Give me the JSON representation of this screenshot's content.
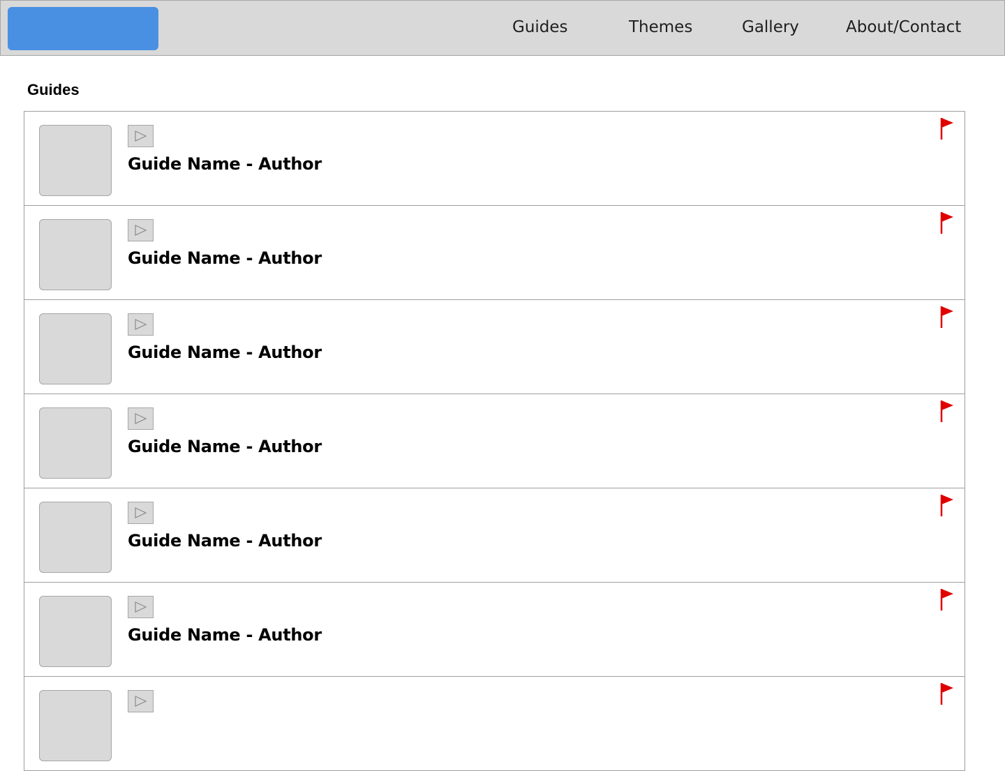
{
  "nav": {
    "links": [
      "Guides",
      "Themes",
      "Gallery",
      "About/Contact"
    ]
  },
  "page": {
    "section_title": "Guides"
  },
  "guides": [
    {
      "title": "Guide Name - Author"
    },
    {
      "title": "Guide Name - Author"
    },
    {
      "title": "Guide Name - Author"
    },
    {
      "title": "Guide Name - Author"
    },
    {
      "title": "Guide Name - Author"
    },
    {
      "title": "Guide Name - Author"
    },
    {
      "title": ""
    }
  ],
  "icons": {
    "play": "play-icon",
    "flag": "flag-icon"
  },
  "colors": {
    "logo": "#4a90e2",
    "flag": "#e00000",
    "navbar": "#d9d9d9",
    "placeholder": "#d9d9d9"
  }
}
